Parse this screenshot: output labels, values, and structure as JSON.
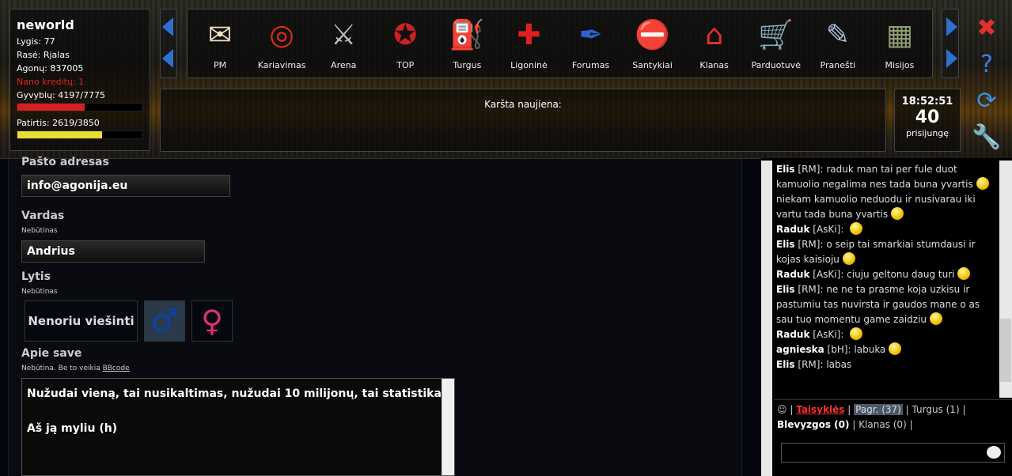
{
  "player": {
    "name": "neworld",
    "level": "Lygis: 77",
    "race": "Rasė: Rjalas",
    "agonies": "Agonų: 837005",
    "nano": "Nano kreditų: 1",
    "health": "Gyvybių: 4197/7775",
    "health_pct": 0.54,
    "exp": "Patirtis: 2619/3850",
    "exp_pct": 0.68,
    "health_color": "#d42020",
    "exp_color": "#e8e030"
  },
  "menu": [
    {
      "label": "PM",
      "icon": "envelope-icon",
      "glyph": "✉",
      "color": "#f0e0c0"
    },
    {
      "label": "Kariavimas",
      "icon": "target-icon",
      "glyph": "◎",
      "color": "#e03010"
    },
    {
      "label": "Arena",
      "icon": "swords-icon",
      "glyph": "⚔",
      "color": "#c0c0c0"
    },
    {
      "label": "TOP",
      "icon": "ribbon-icon",
      "glyph": "✪",
      "color": "#d02020"
    },
    {
      "label": "Turgus",
      "icon": "basket-icon",
      "glyph": "⛽",
      "color": "#f0c000"
    },
    {
      "label": "Ligoninė",
      "icon": "red-cross-icon",
      "glyph": "✚",
      "color": "#e02020"
    },
    {
      "label": "Forumas",
      "icon": "pen-icon",
      "glyph": "✒",
      "color": "#3060d0"
    },
    {
      "label": "Santykiai",
      "icon": "relations-icon",
      "glyph": "⛔",
      "color": "#d02020"
    },
    {
      "label": "Klanas",
      "icon": "houses-icon",
      "glyph": "⌂",
      "color": "#e03030"
    },
    {
      "label": "Parduotuvė",
      "icon": "cart-icon",
      "glyph": "🛒",
      "color": "#8090c0"
    },
    {
      "label": "Pranešti",
      "icon": "speech-icon",
      "glyph": "✎",
      "color": "#b0c0e0"
    },
    {
      "label": "Misijos",
      "icon": "map-icon",
      "glyph": "▦",
      "color": "#90a070"
    }
  ],
  "news": {
    "label": "Karšta naujiena:"
  },
  "clock": {
    "time": "18:52:51",
    "online": "40",
    "online_label": "prisijungę"
  },
  "side": [
    {
      "icon": "close-icon",
      "glyph": "✖",
      "color": "#e03030"
    },
    {
      "icon": "help-icon",
      "glyph": "?",
      "color": "#3a80e0"
    },
    {
      "icon": "refresh-icon",
      "glyph": "⟳",
      "color": "#3a90e0"
    },
    {
      "icon": "wrench-icon",
      "glyph": "🔧",
      "color": "#bbbbbb"
    }
  ],
  "form": {
    "email_label": "Pašto adresas",
    "email_value": "info@agonija.eu",
    "name_label": "Vardas",
    "name_hint": "Nebūtinas",
    "name_value": "Andrius",
    "gender_label": "Lytis",
    "gender_hint": "Nebūtinas",
    "gender_none": "Nenoriu viešinti",
    "male": "♂",
    "female": "♀",
    "about_label": "Apie save",
    "about_hint": "Nebūtina. Be to veikia ",
    "bbcode": "BBcode",
    "about_line1": "Nužudai vieną, tai nusikaltimas, nužudai 10 milijonų, tai statistika.",
    "about_line2": "Aš ją myliu (h)"
  },
  "chat": [
    {
      "user": "Elis",
      "tag": "[RM]",
      "text": "raduk man tai per fule duot kamuolio negalima nes tada buna yvartis",
      "smile": true,
      "text2": "niekam kamuolio neduodu ir nusivarau iki vartu tada buna yvartis",
      "smile2": true
    },
    {
      "user": "Raduk",
      "tag": "[AsKi]",
      "text": "",
      "smile": true
    },
    {
      "user": "Elis",
      "tag": "[RM]",
      "text": "o seip tai smarkiai stumdausi ir kojas kaisioju",
      "smile": true
    },
    {
      "user": "Raduk",
      "tag": "[AsKi]",
      "text": "ciuju geltonu daug turi",
      "smile": true
    },
    {
      "user": "Elis",
      "tag": "[RM]",
      "text": "ne ne ta prasme koja uzkisu ir pastumiu tas nuvirsta ir gaudos mane o as sau tuo momentu game zaidziu",
      "smile": true
    },
    {
      "user": "Raduk",
      "tag": "[AsKi]",
      "text": "",
      "smile": true
    },
    {
      "user": "agnieska",
      "tag": "[bH]",
      "text": "labuka",
      "smile": true
    },
    {
      "user": "Elis",
      "tag": "[RM]",
      "text": "labas",
      "smile": false
    }
  ],
  "chat_tabs": {
    "rules": "Taisyklės",
    "main": "Pagr. (37)",
    "market": "Turgus (1)",
    "swear": "Blevyzgos (0)",
    "clan": "Klanas (0)"
  }
}
